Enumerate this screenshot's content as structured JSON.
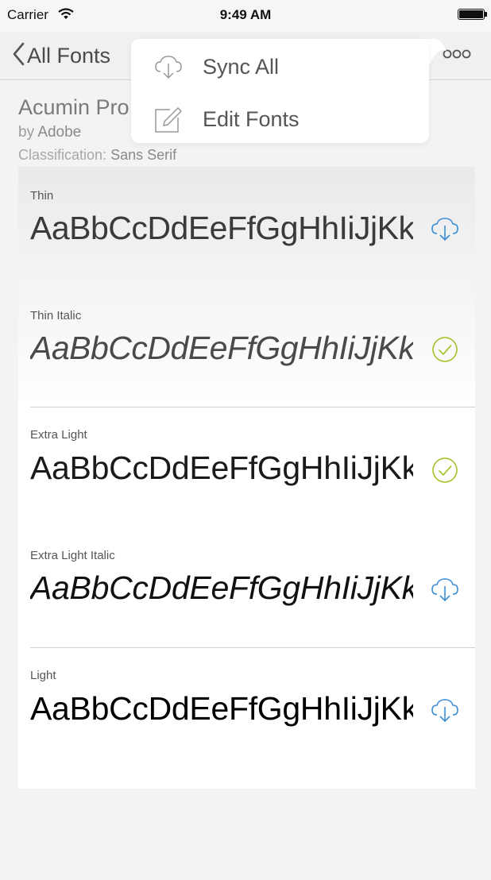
{
  "status_bar": {
    "carrier": "Carrier",
    "time": "9:49 AM"
  },
  "nav": {
    "back_label": "All Fonts",
    "more_icon": "more-icon"
  },
  "font": {
    "name": "Acumin Pro",
    "by_prefix": "by",
    "foundry": "Adobe",
    "classification_label": "Classification:",
    "classification_value": "Sans Serif"
  },
  "styles": [
    {
      "label": "Thin",
      "sample": "AaBbCcDdEeFfGgHhIiJjKk",
      "status": "sync",
      "icon": "cloud-download-icon"
    },
    {
      "label": "Thin Italic",
      "sample": "AaBbCcDdEeFfGgHhIiJjKk",
      "status": "synced",
      "icon": "checkmark-circle-icon"
    },
    {
      "label": "Extra Light",
      "sample": "AaBbCcDdEeFfGgHhIiJjKk",
      "status": "synced",
      "icon": "checkmark-circle-icon"
    },
    {
      "label": "Extra Light Italic",
      "sample": "AaBbCcDdEeFfGgHhIiJjKk",
      "status": "sync",
      "icon": "cloud-download-icon"
    },
    {
      "label": "Light",
      "sample": "AaBbCcDdEeFfGgHhIiJjKk",
      "status": "sync",
      "icon": "cloud-download-icon"
    }
  ],
  "menu": {
    "items": [
      {
        "label": "Sync All",
        "icon": "cloud-download-icon"
      },
      {
        "label": "Edit Fonts",
        "icon": "edit-icon"
      }
    ]
  },
  "colors": {
    "sync_blue": "#3d8fd6",
    "synced_green": "#a9c93a"
  }
}
